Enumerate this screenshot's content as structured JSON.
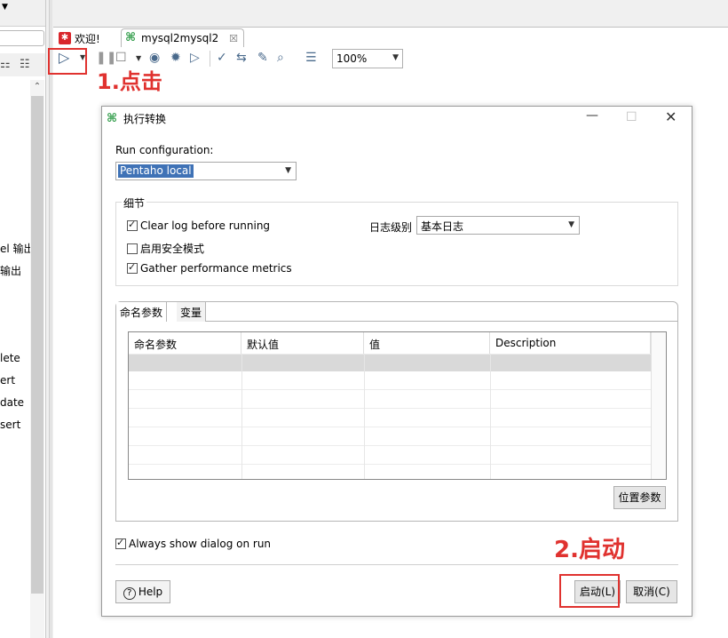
{
  "left_pane": {
    "items": [
      "el 输出",
      "输出",
      "lete",
      "ert",
      "date",
      "sert"
    ]
  },
  "tabs": {
    "welcome": "欢迎!",
    "active": "mysql2mysql2",
    "close_glyph": "☒"
  },
  "toolbar": {
    "zoom": "100%"
  },
  "annotations": {
    "step1": "1.点击",
    "step2": "2.启动",
    "color": "#e0322f"
  },
  "dialog": {
    "title": "执行转换",
    "run_config_label": "Run configuration:",
    "run_config_value": "Pentaho local",
    "details_legend": "细节",
    "clear_log": "Clear log before running",
    "clear_log_checked": true,
    "safe_mode": "启用安全模式",
    "safe_mode_checked": false,
    "gather_metrics": "Gather performance metrics",
    "gather_metrics_checked": true,
    "log_level_label": "日志级别",
    "log_level_value": "基本日志",
    "tab_named_params": "命名参数",
    "tab_variables": "变量",
    "columns": [
      "命名参数",
      "默认值",
      "值",
      "Description"
    ],
    "position_params_button": "位置参数",
    "always_show": "Always show dialog on run",
    "always_show_checked": true,
    "help_button": "Help",
    "start_button": "启动(L)",
    "cancel_button": "取消(C)"
  }
}
